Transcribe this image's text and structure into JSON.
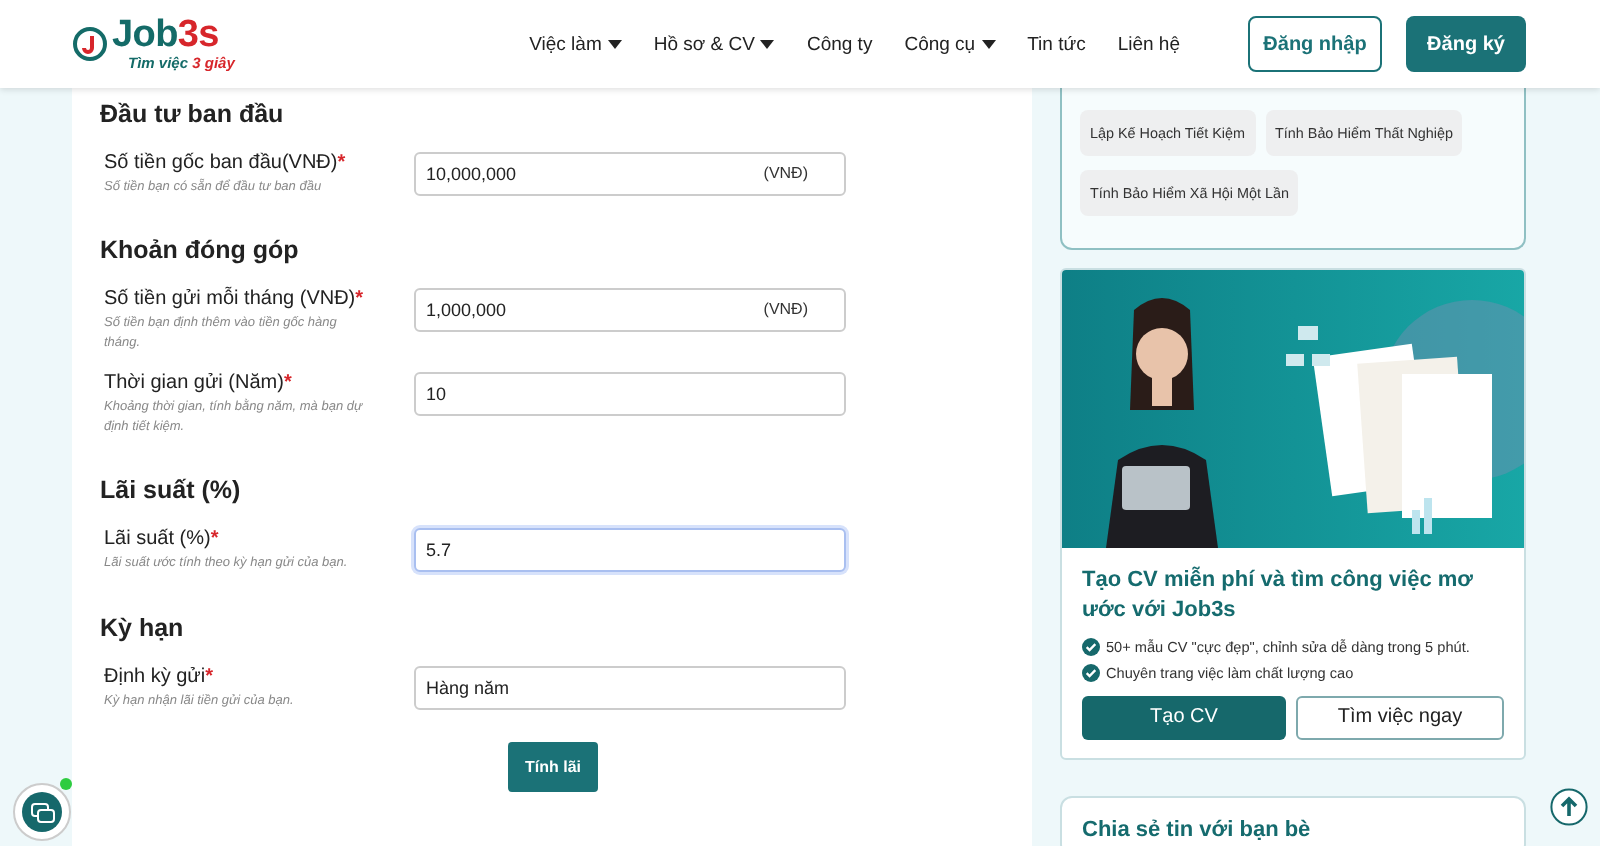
{
  "header": {
    "logo": {
      "text": "Job",
      "accent": "3s",
      "tagline": "Tìm việc",
      "tagline_accent": "3 giây"
    },
    "nav": [
      {
        "label": "Việc làm",
        "dropdown": true
      },
      {
        "label": "Hồ sơ & CV",
        "dropdown": true
      },
      {
        "label": "Công ty",
        "dropdown": false
      },
      {
        "label": "Công cụ",
        "dropdown": true
      },
      {
        "label": "Tin tức",
        "dropdown": false
      },
      {
        "label": "Liên hệ",
        "dropdown": false
      }
    ],
    "login": "Đăng nhập",
    "register": "Đăng ký"
  },
  "form": {
    "sections": [
      {
        "heading": "Đầu tư ban đầu",
        "fields": [
          {
            "label": "Số tiền gốc ban đầu(VNĐ)",
            "required_mark": "*",
            "hint": "Số tiền bạn có sẵn để đầu tư ban đầu",
            "value": "10,000,000",
            "unit": "(VNĐ)",
            "focused": false
          }
        ]
      },
      {
        "heading": "Khoản đóng góp",
        "fields": [
          {
            "label": "Số tiền gửi mỗi tháng (VNĐ)",
            "required_mark": "*",
            "hint": "Số tiền bạn định thêm vào tiền gốc hàng tháng.",
            "value": "1,000,000",
            "unit": "(VNĐ)",
            "focused": false
          },
          {
            "label": "Thời gian gửi (Năm)",
            "required_mark": "*",
            "hint": "Khoảng thời gian, tính bằng năm, mà bạn dự định tiết kiệm.",
            "value": "10",
            "focused": false
          }
        ]
      },
      {
        "heading": "Lãi suất (%)",
        "fields": [
          {
            "label": "Lãi suất (%)",
            "required_mark": "*",
            "hint": "Lãi suất ước tính theo kỳ hạn gửi của bạn.",
            "value": "5.7",
            "focused": true
          }
        ]
      },
      {
        "heading": "Kỳ hạn",
        "fields": [
          {
            "label": "Định kỳ gửi",
            "required_mark": "*",
            "hint": "Kỳ hạn nhận lãi tiền gửi của bạn.",
            "value": "Hàng năm",
            "focused": false
          }
        ]
      }
    ],
    "submit": "Tính lãi"
  },
  "sidebar": {
    "tools": [
      "Lập Kế Hoạch Tiết Kiệm",
      "Tính Bảo Hiểm Thất Nghiệp",
      "Tính Bảo Hiểm Xã Hội Một Lần"
    ],
    "promo": {
      "image": {
        "kind": "picture"
      },
      "title": "Tạo CV miễn phí và tìm công việc mơ ước với Job3s",
      "bullets": [
        "50+ mẫu CV \"cực đẹp\", chỉnh sửa dễ dàng trong 5 phút.",
        "Chuyên trang việc làm chất lượng cao"
      ],
      "primary": "Tạo CV",
      "secondary": "Tìm việc ngay"
    },
    "share_title": "Chia sẻ tin với bạn bè"
  }
}
